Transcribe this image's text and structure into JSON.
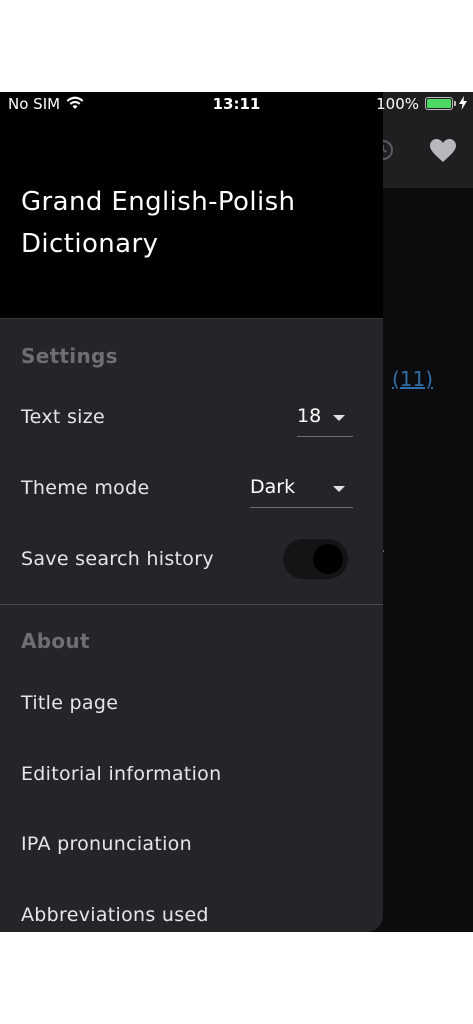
{
  "status_bar": {
    "carrier": "No SIM",
    "time": "13:11",
    "battery": "100%"
  },
  "background": {
    "link_text": "(11)",
    "icons": [
      "history-icon",
      "heart-icon"
    ]
  },
  "drawer": {
    "title": "Grand English-Polish Dictionary",
    "settings": {
      "heading": "Settings",
      "text_size_label": "Text size",
      "text_size_value": "18",
      "theme_mode_label": "Theme mode",
      "theme_mode_value": "Dark",
      "search_history_label": "Save search history",
      "search_history_on": true
    },
    "about": {
      "heading": "About",
      "items": [
        "Title page",
        "Editorial information",
        "IPA pronunciation",
        "Abbreviations used"
      ]
    }
  },
  "colors": {
    "drawer_bg": "#252428",
    "header_bg": "#000000",
    "link": "#2f6fa6",
    "battery": "#4cd964"
  }
}
